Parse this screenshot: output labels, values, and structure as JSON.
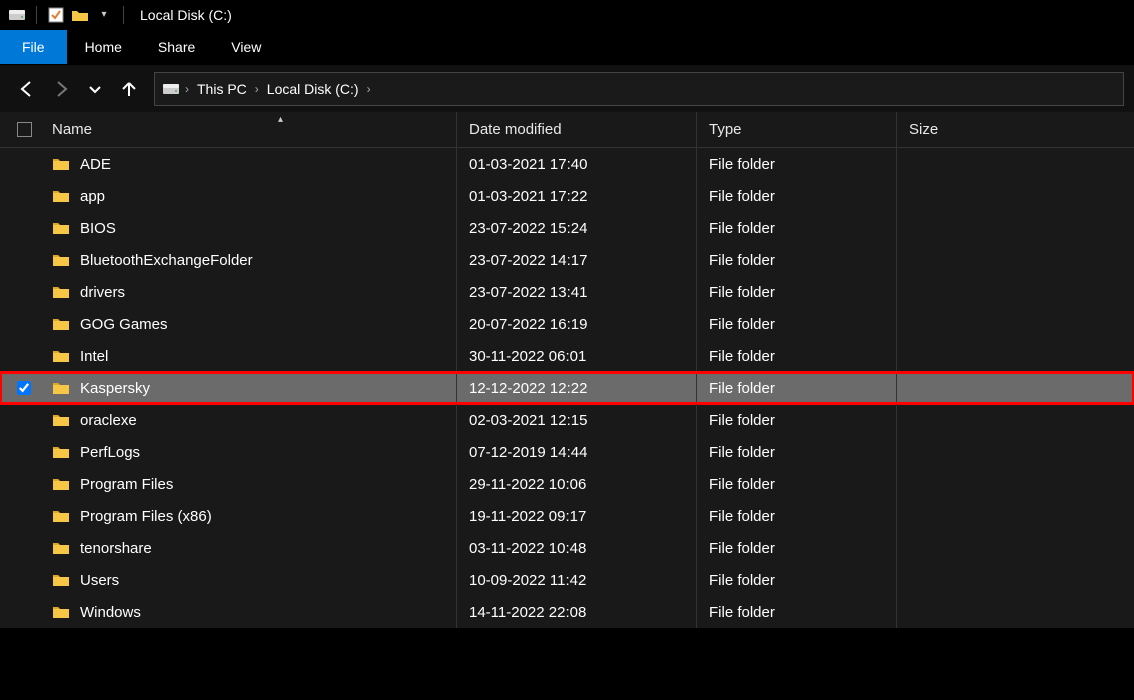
{
  "title": "Local Disk (C:)",
  "menu": {
    "file": "File",
    "home": "Home",
    "share": "Share",
    "view": "View"
  },
  "breadcrumb": {
    "root": "This PC",
    "current": "Local Disk (C:)"
  },
  "columns": {
    "name": "Name",
    "date": "Date modified",
    "type": "Type",
    "size": "Size"
  },
  "rows": [
    {
      "name": "ADE",
      "date": "01-03-2021 17:40",
      "type": "File folder",
      "size": "",
      "selected": false
    },
    {
      "name": "app",
      "date": "01-03-2021 17:22",
      "type": "File folder",
      "size": "",
      "selected": false
    },
    {
      "name": "BIOS",
      "date": "23-07-2022 15:24",
      "type": "File folder",
      "size": "",
      "selected": false
    },
    {
      "name": "BluetoothExchangeFolder",
      "date": "23-07-2022 14:17",
      "type": "File folder",
      "size": "",
      "selected": false
    },
    {
      "name": "drivers",
      "date": "23-07-2022 13:41",
      "type": "File folder",
      "size": "",
      "selected": false
    },
    {
      "name": "GOG Games",
      "date": "20-07-2022 16:19",
      "type": "File folder",
      "size": "",
      "selected": false
    },
    {
      "name": "Intel",
      "date": "30-11-2022 06:01",
      "type": "File folder",
      "size": "",
      "selected": false
    },
    {
      "name": "Kaspersky",
      "date": "12-12-2022 12:22",
      "type": "File folder",
      "size": "",
      "selected": true
    },
    {
      "name": "oraclexe",
      "date": "02-03-2021 12:15",
      "type": "File folder",
      "size": "",
      "selected": false
    },
    {
      "name": "PerfLogs",
      "date": "07-12-2019 14:44",
      "type": "File folder",
      "size": "",
      "selected": false
    },
    {
      "name": "Program Files",
      "date": "29-11-2022 10:06",
      "type": "File folder",
      "size": "",
      "selected": false
    },
    {
      "name": "Program Files (x86)",
      "date": "19-11-2022 09:17",
      "type": "File folder",
      "size": "",
      "selected": false
    },
    {
      "name": "tenorshare",
      "date": "03-11-2022 10:48",
      "type": "File folder",
      "size": "",
      "selected": false
    },
    {
      "name": "Users",
      "date": "10-09-2022 11:42",
      "type": "File folder",
      "size": "",
      "selected": false
    },
    {
      "name": "Windows",
      "date": "14-11-2022 22:08",
      "type": "File folder",
      "size": "",
      "selected": false
    }
  ]
}
